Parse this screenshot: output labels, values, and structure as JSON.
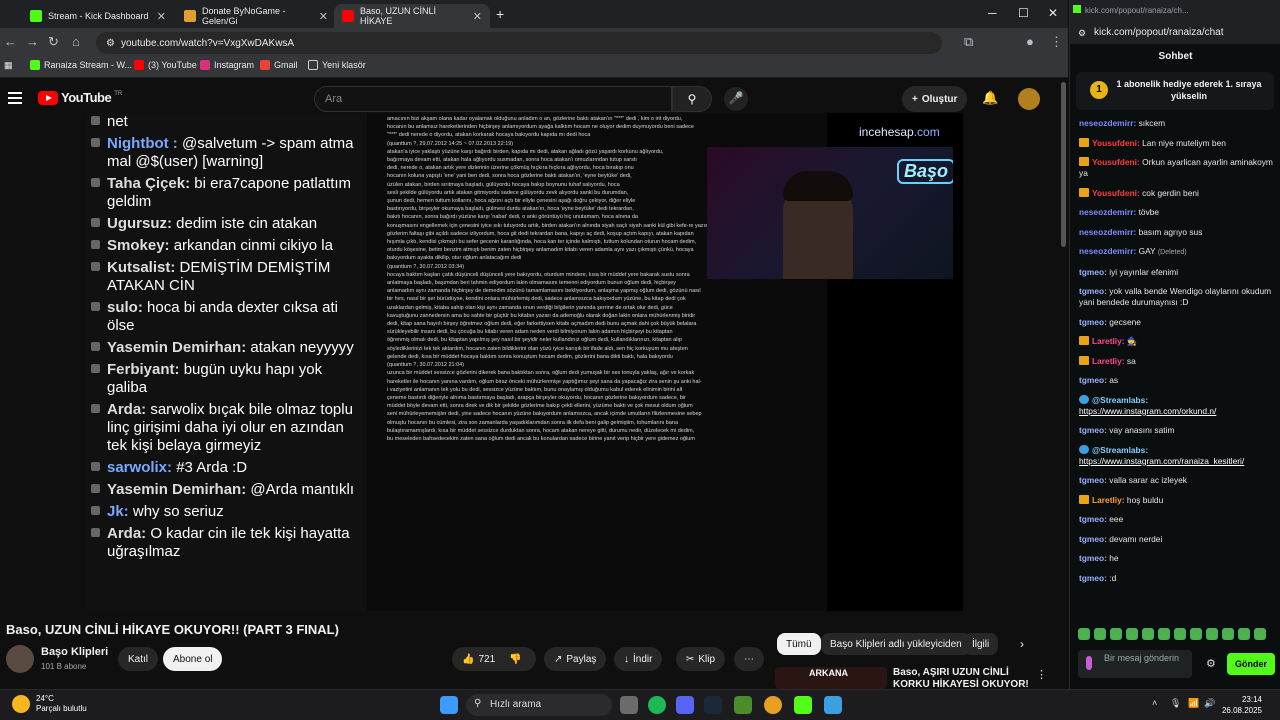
{
  "browser": {
    "tabs": [
      {
        "label": "Stream - Kick Dashboard",
        "color": "#53fc18"
      },
      {
        "label": "Donate ByNoGame - Gelen/Gi",
        "color": "#e0a030"
      },
      {
        "label": "Baso, UZUN CİNLİ HİKAYE",
        "color": "#ff0000"
      }
    ],
    "url": "youtube.com/watch?v=VxgXwDAKwsA",
    "bookmarks": [
      "Ranaiza Stream - W...",
      "(3) YouTube",
      "Instagram",
      "Gmail",
      "Yeni klasör"
    ]
  },
  "youtube": {
    "search_placeholder": "Ara",
    "create_label": "Oluştur",
    "video_title": "Baso, UZUN CİNLİ HİKAYE OKUYOR!! (PART 3 FINAL)",
    "channel_name": "Başo Klipleri",
    "channel_subs": "101 B abone",
    "join_label": "Katıl",
    "subscribe_label": "Abone ol",
    "like_count": "721",
    "share_label": "Paylaş",
    "download_label": "İndir",
    "clip_label": "Klip",
    "filters": [
      "Tümü",
      "Başo Klipleri adlı yükleyiciden",
      "İlgili"
    ],
    "next_video_title": "Baso, AŞIRI UZUN CİNLİ KORKU HİKAYESİ OKUYOR!",
    "next_video_thumb_text": "ARKANA"
  },
  "video_chat": [
    {
      "name": "",
      "text": "net"
    },
    {
      "name": "Nightbot :",
      "text": "@salvetum -> spam atma mal @$(user) [warning]",
      "bot": true
    },
    {
      "name": "Taha Çiçek:",
      "text": "bi era7capone patlattım geldim"
    },
    {
      "name": "Ugursuz:",
      "text": "dedim iste cin atakan"
    },
    {
      "name": "Smokey:",
      "text": "arkandan cinmi cikiyo la"
    },
    {
      "name": "Kutsalist:",
      "text": "DEMİŞTİM DEMİŞTİM ATAKAN CİN"
    },
    {
      "name": "sulo:",
      "text": "hoca bi anda dexter cıksa ati ölse"
    },
    {
      "name": "Yasemin Demirhan:",
      "text": "atakan neyyyyy"
    },
    {
      "name": "Ferbiyant:",
      "text": "bugün uyku hapı yok galiba"
    },
    {
      "name": "Arda:",
      "text": "sarwolix bıçak bile olmaz toplu linç girişimi daha iyi olur en azından tek kişi belaya girmeyiz"
    },
    {
      "name": "sarwolix:",
      "text": "#3 Arda :D",
      "bot": true
    },
    {
      "name": "Yasemin Demirhan:",
      "text": "@Arda mantıklı"
    },
    {
      "name": "Jk:",
      "text": "why so seriuz",
      "bot": true
    },
    {
      "name": "Arda:",
      "text": "O kadar cin ile tek kişi hayatta uğraşılmaz"
    }
  ],
  "doc_text": [
    "amacının bizi akşam olana kadar oyalamak olduğunu anladım o an, gözlerine baktı atakan'ın \"***\" dedi , kim o irit diyordu,",
    "hocanın bu anlamsız hareketlerinden hiçbirşey anlamıyordum ayağa kalktım hocam ne oluyor dedim duymuyordu beni sadece",
    "\"***\" dedi nerede o diyordu, atakan korkarak hocaya bakıyordu kapıda mı dedi hoca",
    "(quanttum ?, 29.07.2012 14:25 ~ 07.02.2013 22:19)",
    "atakan'a iyice yaklaştı yüzüne karşı bağırdı birden, kapıda mı dedi, atakan ağladı gözü yaşardı korkunu ağlıyordu,",
    "bağırmaya devam etti, atakan hala ağlıyordu susmadan, sonra hoca atakan'ı omuzlarından tutup sarstı",
    "dedi, nerede o, atakan artık yere dizlerinin üzerine çökmüş hıçkıra hıçkıra ağlıyordu, hoca bırakıp onu",
    "hocanın koluna yapıştı 'ene' yani ben dedi, sonra hoca gözlerine baktı atakan'ın, 'eyne beytüke' dedi,",
    "üzülen atakan, birden sırıtmaya başladı, gülüyordu hocaya bakıp boynunu tuhaf salıyordu, hoca",
    "sesli şekilde gülüyordu artık atakan gitmiyordu sadece gülüyordu zevk alıyordu sanki bu durumdan,",
    "şunun dedi, hemen tuttum kollarını, hoca ağzını açtı bir eliyle çenesini aşağı doğru çekiyor, diğer eliyle",
    "bastırıyordu, birşeyler okumaya başladı, gülmesi durdu atakan'ın, hoca 'eyne beytüke' dedi tekrardan,",
    "bakıtı hocanın, sonra bağırdı yüzüne karşı 'nabat' dedi, o anki görüntüyü hiç unutamam, hoca alnına da",
    "konuşmasını engellemek için çenesini iyice sıkı tutuyordu artık, birden atakan'ın alnında siyah saçlı siyah sanki kül gibi kefe-re yazısı çıktı,",
    "gözlerim faltaşı gibi açıldı sadece izliyordum, hoca git dedi tekrardan bana, kapıyı aç dedi, koşup açtım kapıyı, atakan kapıdan",
    "hışımla çıktı, kendisi çıkmıştı bu sefer gecenin karanlığında, hoca kan ter içinde kalmıştı, tuttum kolundan oturun hocam dedim,",
    "oturdu köşesine, betim benzim atmıştı benim zaten hiçbirşey anlamadım kitabı veren adamla aynı yazı çıkmıştı çünkü, hocaya",
    "bakıyordum ayakta dikilip, otur oğlum anlatacağım dedi",
    "(quanttum ?, 30.07.2012 03:34)",
    "hocaya baktım kaşları çatık düşünceli düşünceli yere bakıyordu, oturdum mindere, kısa bir müddet yere bakarak sustu sonra",
    "anlatmaya başladı, başımdan beri tahmin ediyordum lakin olmamasını temenni ediyordum bunun oğlum dedi, hiçbirşey",
    "anlamadım aynı zamanda hiçbirşey de demedim sözünü tamamlamasını bekliyordum, anlaşma yapmış oğlum dedi, gözünü nasıl",
    "bir hırs, nasıl bir şer bürüdüyse, kendini onlara mühürlemiş dedi, sadece anlamsızca bakıyordum yüzüne, bu kitap dedi çok",
    "uzaklardan gelmiş, kitaba sahip olan kişi aynı zamanda onun verdiği bilgilerin yanında şerrine de ortak olur dedi, güce",
    "kavuştuğunu zannedersin ama bu sahte bir güçtür bu kitabın yazarı da ademoğlu olarak doğan lakin onlara mühürlenmiş biridir",
    "dedi, kitap sana hayırlı birşey öğretmez oğlum dedi, eğer farkettiysen kitabı açmadım dedi bunu açmak dahi çok büyük belalara",
    "sürükleyebilir insanı dedi, bu çocuğa bu kitabı veren adam neden verdi bilmiyorum lakin adamın hiçbirşeyi bu kitaptan",
    "öğrenmiş olmalı dedi, bu kitaptan yapılmış şey nasıl bir şeyidir neler kullandınız oğlum dedi, kullandıklarınızı, kitaptan alıp",
    "söylediklerinizi tek tek aktardım, hocanın zaten bildiklerini olan yüzü iyice karışık bir ifade aldı, sen hiç korkuyum mu ateşten",
    "gelende dedi, kısa bir müddet hocaya baktım sonra konuştum hocam dedim, gözlerini bana dikti baktı, hala bakıyordu",
    "(quanttum ?, 30.07.2012 21:04)",
    "uzunca bir müddet sessizce gözlerini dikerek bana baktıktan sonra, oğlum dedi yumuşak bir ses tonuyla yaklaş, ağır ve korkak",
    "hareketler ile hocanın yanına vardım, oğlum biraz önceki mühürlenmişe yaptığımız şeyi sana da yapacağız zira senin şu anki hal-",
    "i vaziyetini anlamanın tek yolu bu dedi, sessizce yüzüne baktım, bunu onaylamış olduğumu kabul ederek elinimin birini alt",
    "çeneme bastırdı diğeriyle alnıma bastırmaya başladı, arapça birşeyler okuyordu, hocanın gözlerine bakıyordum sadece, bir",
    "müddet böyle devam etti, sonra direk ve dik bir şekilde gözlerime bakıp çekti ellerini, yüzüme baktı ve çok mesut oldum oğlum",
    "seni mühürleyememişler dedi, yine sadece hocanın yüzüne bakıyordum anlamsızca, ancak içimde umutların filizlenmesine sebep",
    "olmuştu hocanın bu cümlesi, zira son zamanlarda yaşadıklarımdan sonra ilk defa beni galip gelmiştim, tohumlarını bana",
    "bulaştıramamışlardı, kısa bir müddet sessizce durduktan sonra, hocam atakan nereye gitti, durumu nedir, düzelecek mi dedim,",
    "bu meseleden bahsedecekim zaten sana oğlum dedi ancak bu konulardan sadece birine yanıt verip hiçbir yere gidemez oğlum"
  ],
  "video_overlay": {
    "brand": "incehesap",
    "brand_suffix": ".com",
    "neon_sign": "Başo"
  },
  "kick": {
    "addr": "kick.com/popout/ranaiza/chat",
    "title_bar": "kick.com/popout/ranaiza/ch...",
    "header": "Sohbet",
    "pinned": "1 abonelik hediye ederek 1. sıraya yükselin",
    "pinned_badge": "1",
    "messages": [
      {
        "user": "neseozdemirr:",
        "text": "sıkcem",
        "badge": "",
        "color": "#7e8cff"
      },
      {
        "user": "Yousufdeni:",
        "text": "Lan niye muteliym ben",
        "badge": "sub",
        "color": "#ff3b3b"
      },
      {
        "user": "Yousufdeni:",
        "text": "Orkun ayarlican ayarlin aminakoym ya",
        "badge": "sub",
        "color": "#ff3b3b"
      },
      {
        "user": "Yousufdeni:",
        "text": "cok gerdin beni",
        "badge": "sub",
        "color": "#ff3b3b"
      },
      {
        "user": "neseozdemirr:",
        "text": "tövbe",
        "badge": "",
        "color": "#7e8cff"
      },
      {
        "user": "neseozdemirr:",
        "text": "basım agrıyo sus",
        "badge": "",
        "color": "#7e8cff"
      },
      {
        "user": "neseozdemirr:",
        "text": "GAY",
        "deleted": "(Deleted)",
        "badge": "",
        "color": "#7e8cff"
      },
      {
        "user": "tgmeo:",
        "text": "iyi yayınlar efenimi",
        "badge": "",
        "color": "#9ab0ff"
      },
      {
        "user": "tgmeo:",
        "text": "yok valla bende Wendigo olaylarını okudum yani bendede durumaynısı :D",
        "badge": "",
        "color": "#9ab0ff"
      },
      {
        "user": "tgmeo:",
        "text": "gecsene",
        "badge": "",
        "color": "#9ab0ff"
      },
      {
        "user": "Laretliy:",
        "text": "🧙",
        "badge": "sub",
        "color": "#ff4a8a"
      },
      {
        "user": "Laretliy:",
        "text": "sa",
        "badge": "sub",
        "color": "#ff4a8a"
      },
      {
        "user": "tgmeo:",
        "text": "as",
        "badge": "",
        "color": "#9ab0ff"
      },
      {
        "user": "@Streamlabs:",
        "text": "https://www.instagram.com/orkund.n/",
        "badge": "bot",
        "color": "#7fd0ff",
        "link": true
      },
      {
        "user": "tgmeo:",
        "text": "vay anasını satim",
        "badge": "",
        "color": "#9ab0ff"
      },
      {
        "user": "@Streamlabs:",
        "text": "https://www.instagram.com/ranaiza_kesitleri/",
        "badge": "bot",
        "color": "#7fd0ff",
        "link": true
      },
      {
        "user": "tgmeo:",
        "text": "valla sarar ac izleyek",
        "badge": "",
        "color": "#9ab0ff"
      },
      {
        "user": "Laretliy:",
        "text": "hoş buldu",
        "badge": "sub",
        "color": "#ff9a3a"
      },
      {
        "user": "tgmeo:",
        "text": "eee",
        "badge": "",
        "color": "#9ab0ff"
      },
      {
        "user": "tgmeo:",
        "text": "devamı nerdei",
        "badge": "",
        "color": "#9ab0ff"
      },
      {
        "user": "tgmeo:",
        "text": "he",
        "badge": "",
        "color": "#9ab0ff"
      },
      {
        "user": "tgmeo:",
        "text": ":d",
        "badge": "",
        "color": "#9ab0ff"
      }
    ],
    "input_placeholder": "Bir mesaj gönderin",
    "send_label": "Gönder"
  },
  "taskbar": {
    "temp": "24°C",
    "weather": "Parçalı bulutlu",
    "search_label": "Hızlı arama",
    "time": "23:14",
    "date": "26.08.2025"
  }
}
